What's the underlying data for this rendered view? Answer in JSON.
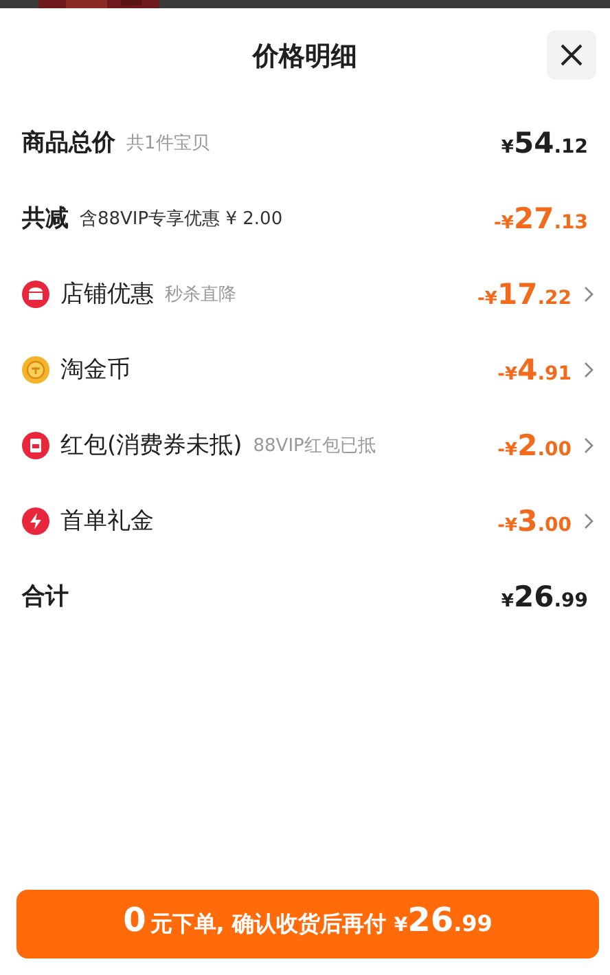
{
  "title": "价格明细",
  "rows": [
    {
      "kind": "total",
      "label": "商品总价",
      "note": "共1件宝贝",
      "amount": "¥54.12"
    },
    {
      "kind": "reduction",
      "label": "共减",
      "note": "含88VIP专享优惠 ¥ 2.00",
      "amount": "-¥27.13"
    },
    {
      "kind": "discount",
      "label": "店铺优惠",
      "note": "秒杀直降",
      "amount": "-¥17.22"
    },
    {
      "kind": "discount",
      "label": "淘金币",
      "amount": "-¥4.91"
    },
    {
      "kind": "discount",
      "label": "红包(消费券未抵)",
      "note": "88VIP红包已抵",
      "amount": "-¥2.00"
    },
    {
      "kind": "discount",
      "label": "首单礼金",
      "amount": "-¥3.00"
    },
    {
      "kind": "total",
      "label": "合计",
      "amount": "¥26.99"
    }
  ],
  "button": {
    "lead": "0",
    "text": "元下单, 确认收货后再付",
    "amount": "¥26.99"
  }
}
